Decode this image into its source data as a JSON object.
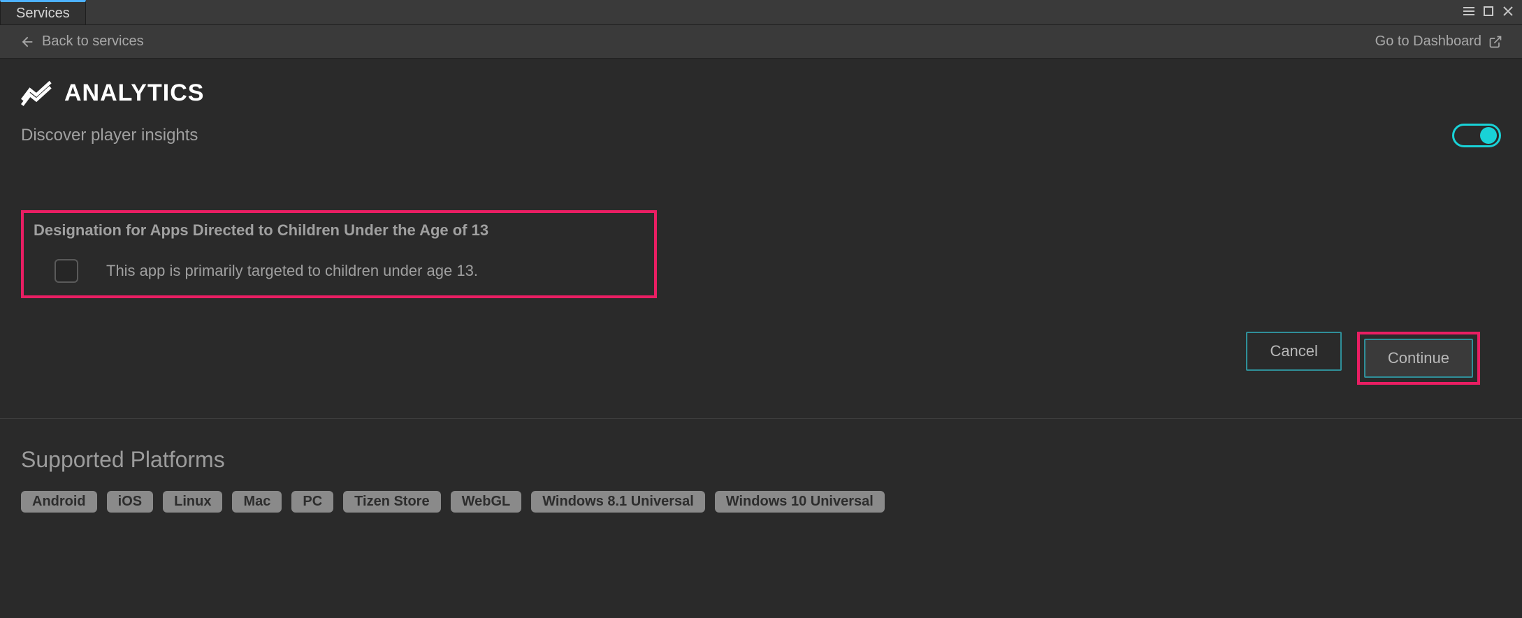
{
  "tab": {
    "label": "Services"
  },
  "nav": {
    "back_label": "Back to services",
    "dashboard_label": "Go to Dashboard"
  },
  "service": {
    "name": "ANALYTICS",
    "tagline": "Discover player insights",
    "enabled": true
  },
  "designation": {
    "heading": "Designation for Apps Directed to Children Under the Age of 13",
    "checkbox_label": "This app is primarily targeted to children under age 13.",
    "checked": false
  },
  "actions": {
    "cancel": "Cancel",
    "continue": "Continue"
  },
  "platforms": {
    "heading": "Supported Platforms",
    "list": [
      "Android",
      "iOS",
      "Linux",
      "Mac",
      "PC",
      "Tizen Store",
      "WebGL",
      "Windows 8.1 Universal",
      "Windows 10 Universal"
    ]
  },
  "annotations": {
    "highlight_color": "#e91e63",
    "accent_color": "#19d2d7"
  }
}
